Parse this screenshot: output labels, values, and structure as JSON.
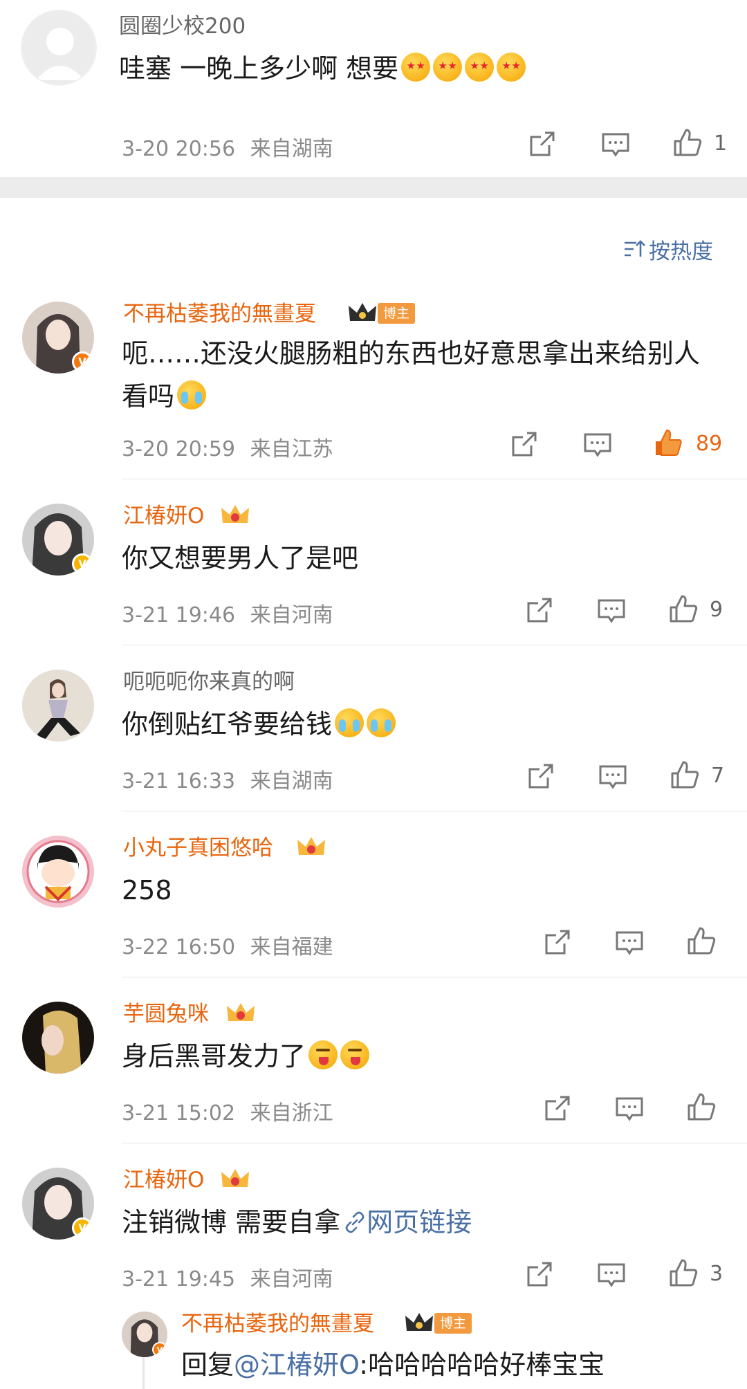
{
  "top_comment": {
    "name": "圆圈少校200",
    "text": "哇塞  一晚上多少啊  想要",
    "emoji_icons": [
      "star-struck-emoji",
      "star-struck-emoji",
      "star-struck-emoji",
      "star-struck-emoji"
    ],
    "time": "3-20 20:56",
    "location": "来自湖南",
    "likes": "1"
  },
  "sort": {
    "label": "按热度",
    "icon": "sort-icon"
  },
  "comments": [
    {
      "name": "不再枯萎我的無畫夏",
      "blogger_tag": "博主",
      "text": "呃……还没火腿肠粗的东西也好意思拿出来给别人看吗",
      "time": "3-20 20:59",
      "location": "来自江苏",
      "likes": "89",
      "liked": true
    },
    {
      "name": "江椿妍O",
      "text": "你又想要男人了是吧",
      "time": "3-21 19:46",
      "location": "来自河南",
      "likes": "9"
    },
    {
      "name": "呃呃呃你来真的啊",
      "text": "你倒贴红爷要给钱",
      "time": "3-21 16:33",
      "location": "来自湖南",
      "likes": "7"
    },
    {
      "name": "小丸子真困悠哈",
      "text": "258",
      "time": "3-22 16:50",
      "location": "来自福建",
      "likes": ""
    },
    {
      "name": "芋圆兔咪",
      "text": "身后黑哥发力了",
      "time": "3-21 15:02",
      "location": "来自浙江",
      "likes": ""
    },
    {
      "name": "江椿妍O",
      "text_prefix": "注销微博 需要自拿",
      "link_label": "网页链接",
      "time": "3-21 19:45",
      "location": "来自河南",
      "likes": "3"
    }
  ],
  "reply": {
    "name": "不再枯萎我的無畫夏",
    "blogger_tag": "博主",
    "reply_prefix": "回复",
    "mention": "@江椿妍O",
    "text": ":哈哈哈哈哈好棒宝宝"
  },
  "colors": {
    "accent_orange": "#e8650e",
    "link_blue": "#4a6fa5",
    "meta_gray": "#8a8a8a"
  }
}
